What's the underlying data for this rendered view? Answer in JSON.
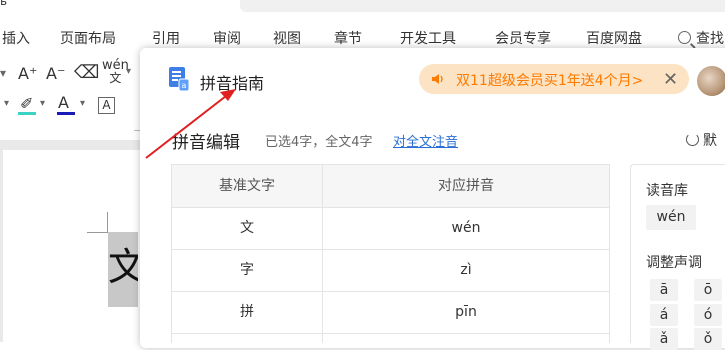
{
  "top": {
    "tab_fragment": "ь"
  },
  "menu": {
    "items": [
      "插入",
      "页面布局",
      "引用",
      "审阅",
      "视图",
      "章节",
      "开发工具",
      "会员专享",
      "百度网盘"
    ],
    "search_label": "查找"
  },
  "toolbar": {
    "grow_font": "A⁺",
    "shrink_font": "A⁻",
    "pinyin_guide": "wén",
    "pinyin_sub": "文",
    "font_color": "A",
    "char_border": "A"
  },
  "document": {
    "selected_char": "文"
  },
  "dialog": {
    "title": "拼音指南",
    "promo": "双11超级会员买1年送4个月>",
    "section_title": "拼音编辑",
    "selection_info": "已选4字，全文4字",
    "annotate_all_link": "对全文注音",
    "reset_label": "默",
    "table": {
      "headers": [
        "基准文字",
        "对应拼音"
      ],
      "rows": [
        {
          "char": "文",
          "pinyin": "wén"
        },
        {
          "char": "字",
          "pinyin": "zì"
        },
        {
          "char": "拼",
          "pinyin": "pīn"
        }
      ]
    },
    "side": {
      "library_label": "读音库",
      "library_value": "wén",
      "tone_label": "调整声调",
      "tones": [
        "ā",
        "ō",
        "á",
        "ó",
        "ǎ",
        "ǒ"
      ]
    }
  },
  "colors": {
    "promo_text": "#ff7a00",
    "promo_bg": "#fbe3c4",
    "link": "#2b6fd4",
    "arrow": "#e02020"
  }
}
